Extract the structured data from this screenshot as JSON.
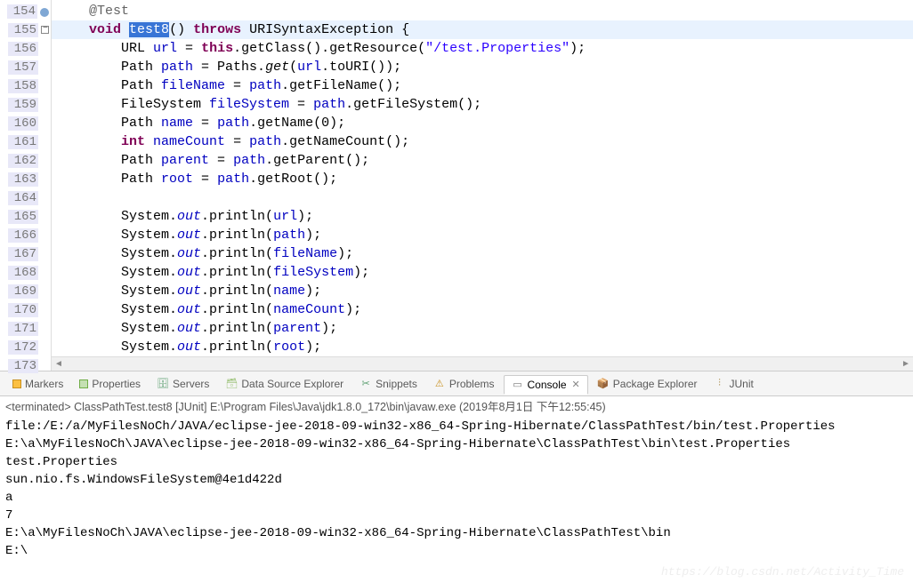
{
  "editor": {
    "lines": [
      {
        "n": "154",
        "marker": "anno",
        "html": "    <span class='ann'>@Test</span>"
      },
      {
        "n": "155",
        "marker": "fold",
        "hl": true,
        "html": "    <span class='kw'>void</span> <span class='sel'>test8</span>() <span class='kw'>throws</span> URISyntaxException {"
      },
      {
        "n": "156",
        "html": "        URL <span class='fld'>url</span> = <span class='kw'>this</span>.getClass().getResource(<span class='str'>\"/test.Properties\"</span>);"
      },
      {
        "n": "157",
        "html": "        Path <span class='fld'>path</span> = Paths.<span class='stm'>get</span>(<span class='fld'>url</span>.toURI());"
      },
      {
        "n": "158",
        "html": "        Path <span class='fld'>fileName</span> = <span class='fld'>path</span>.getFileName();"
      },
      {
        "n": "159",
        "html": "        FileSystem <span class='fld'>fileSystem</span> = <span class='fld'>path</span>.getFileSystem();"
      },
      {
        "n": "160",
        "html": "        Path <span class='fld'>name</span> = <span class='fld'>path</span>.getName(0);"
      },
      {
        "n": "161",
        "html": "        <span class='kw'>int</span> <span class='fld'>nameCount</span> = <span class='fld'>path</span>.getNameCount();"
      },
      {
        "n": "162",
        "html": "        Path <span class='fld'>parent</span> = <span class='fld'>path</span>.getParent();"
      },
      {
        "n": "163",
        "html": "        Path <span class='fld'>root</span> = <span class='fld'>path</span>.getRoot();"
      },
      {
        "n": "164",
        "html": ""
      },
      {
        "n": "165",
        "html": "        System.<span class='stfld'>out</span>.println(<span class='fld'>url</span>);"
      },
      {
        "n": "166",
        "html": "        System.<span class='stfld'>out</span>.println(<span class='fld'>path</span>);"
      },
      {
        "n": "167",
        "html": "        System.<span class='stfld'>out</span>.println(<span class='fld'>fileName</span>);"
      },
      {
        "n": "168",
        "html": "        System.<span class='stfld'>out</span>.println(<span class='fld'>fileSystem</span>);"
      },
      {
        "n": "169",
        "html": "        System.<span class='stfld'>out</span>.println(<span class='fld'>name</span>);"
      },
      {
        "n": "170",
        "html": "        System.<span class='stfld'>out</span>.println(<span class='fld'>nameCount</span>);"
      },
      {
        "n": "171",
        "html": "        System.<span class='stfld'>out</span>.println(<span class='fld'>parent</span>);"
      },
      {
        "n": "172",
        "html": "        System.<span class='stfld'>out</span>.println(<span class='fld'>root</span>);"
      },
      {
        "n": "173",
        "html": "    }"
      }
    ]
  },
  "views": {
    "tabs": [
      {
        "label": "Markers",
        "iconClass": "ico-markers"
      },
      {
        "label": "Properties",
        "iconClass": "ico-props"
      },
      {
        "label": "Servers",
        "iconClass": "ico-servers",
        "glyph": "🗄"
      },
      {
        "label": "Data Source Explorer",
        "iconClass": "ico-dsx",
        "glyph": "🗃"
      },
      {
        "label": "Snippets",
        "iconClass": "ico-snip",
        "glyph": "✂"
      },
      {
        "label": "Problems",
        "iconClass": "ico-prob",
        "glyph": "⚠"
      },
      {
        "label": "Console",
        "iconClass": "ico-cons",
        "glyph": "▭",
        "active": true,
        "closable": true
      },
      {
        "label": "Package Explorer",
        "iconClass": "ico-pkg",
        "glyph": "📦"
      },
      {
        "label": "JUnit",
        "iconClass": "ico-junit",
        "glyph": "⫶"
      }
    ]
  },
  "console": {
    "header": "<terminated> ClassPathTest.test8 [JUnit] E:\\Program Files\\Java\\jdk1.8.0_172\\bin\\javaw.exe (2019年8月1日 下午12:55:45)",
    "lines": [
      "file:/E:/a/MyFilesNoCh/JAVA/eclipse-jee-2018-09-win32-x86_64-Spring-Hibernate/ClassPathTest/bin/test.Properties",
      "E:\\a\\MyFilesNoCh\\JAVA\\eclipse-jee-2018-09-win32-x86_64-Spring-Hibernate\\ClassPathTest\\bin\\test.Properties",
      "test.Properties",
      "sun.nio.fs.WindowsFileSystem@4e1d422d",
      "a",
      "7",
      "E:\\a\\MyFilesNoCh\\JAVA\\eclipse-jee-2018-09-win32-x86_64-Spring-Hibernate\\ClassPathTest\\bin",
      "E:\\"
    ]
  },
  "watermark": "https://blog.csdn.net/Activity_Time"
}
